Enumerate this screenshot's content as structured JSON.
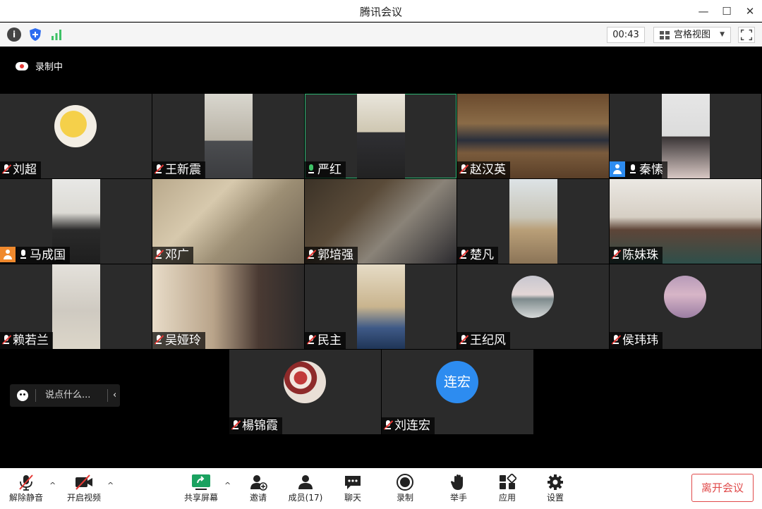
{
  "window": {
    "title": "腾讯会议",
    "minimize": "—",
    "maximize": "☐",
    "close": "✕"
  },
  "topbar": {
    "info": "i",
    "timer": "00:43",
    "view_label": "宫格视图",
    "view_caret": "▼"
  },
  "recording": {
    "label": "录制中"
  },
  "participants": [
    {
      "name": "刘超",
      "mic": "muted"
    },
    {
      "name": "王新震",
      "mic": "muted"
    },
    {
      "name": "严红",
      "mic": "on",
      "active": true
    },
    {
      "name": "赵汉英",
      "mic": "muted"
    },
    {
      "name": "秦愫",
      "mic": "unmuted",
      "badge": "blue"
    },
    {
      "name": "马成国",
      "mic": "unmuted",
      "badge": "orange"
    },
    {
      "name": "邓广",
      "mic": "muted"
    },
    {
      "name": "郭培强",
      "mic": "muted"
    },
    {
      "name": "楚凡",
      "mic": "muted"
    },
    {
      "name": "陈妹珠",
      "mic": "muted"
    },
    {
      "name": "赖若兰",
      "mic": "muted"
    },
    {
      "name": "吴娅玲",
      "mic": "muted"
    },
    {
      "name": "民主",
      "mic": "muted"
    },
    {
      "name": "王纪风",
      "mic": "muted"
    },
    {
      "name": "侯玮玮",
      "mic": "muted"
    },
    {
      "name": "楊锦霞",
      "mic": "muted"
    },
    {
      "name": "刘连宏",
      "mic": "muted",
      "avatar_text": "连宏"
    }
  ],
  "chat": {
    "placeholder": "说点什么...",
    "collapse": "‹"
  },
  "toolbar": {
    "unmute": "解除静音",
    "start_video": "开启视频",
    "share_screen": "共享屏幕",
    "invite": "邀请",
    "members": "成员(17)",
    "chat": "聊天",
    "record": "录制",
    "raise_hand": "举手",
    "apps": "应用",
    "settings": "设置",
    "leave": "离开会议",
    "caret": "^"
  },
  "colors": {
    "accent_blue": "#2d8cf0",
    "muted_red": "#e53935",
    "speaking_green": "#3ec166",
    "leave_red": "#e04a4a"
  }
}
